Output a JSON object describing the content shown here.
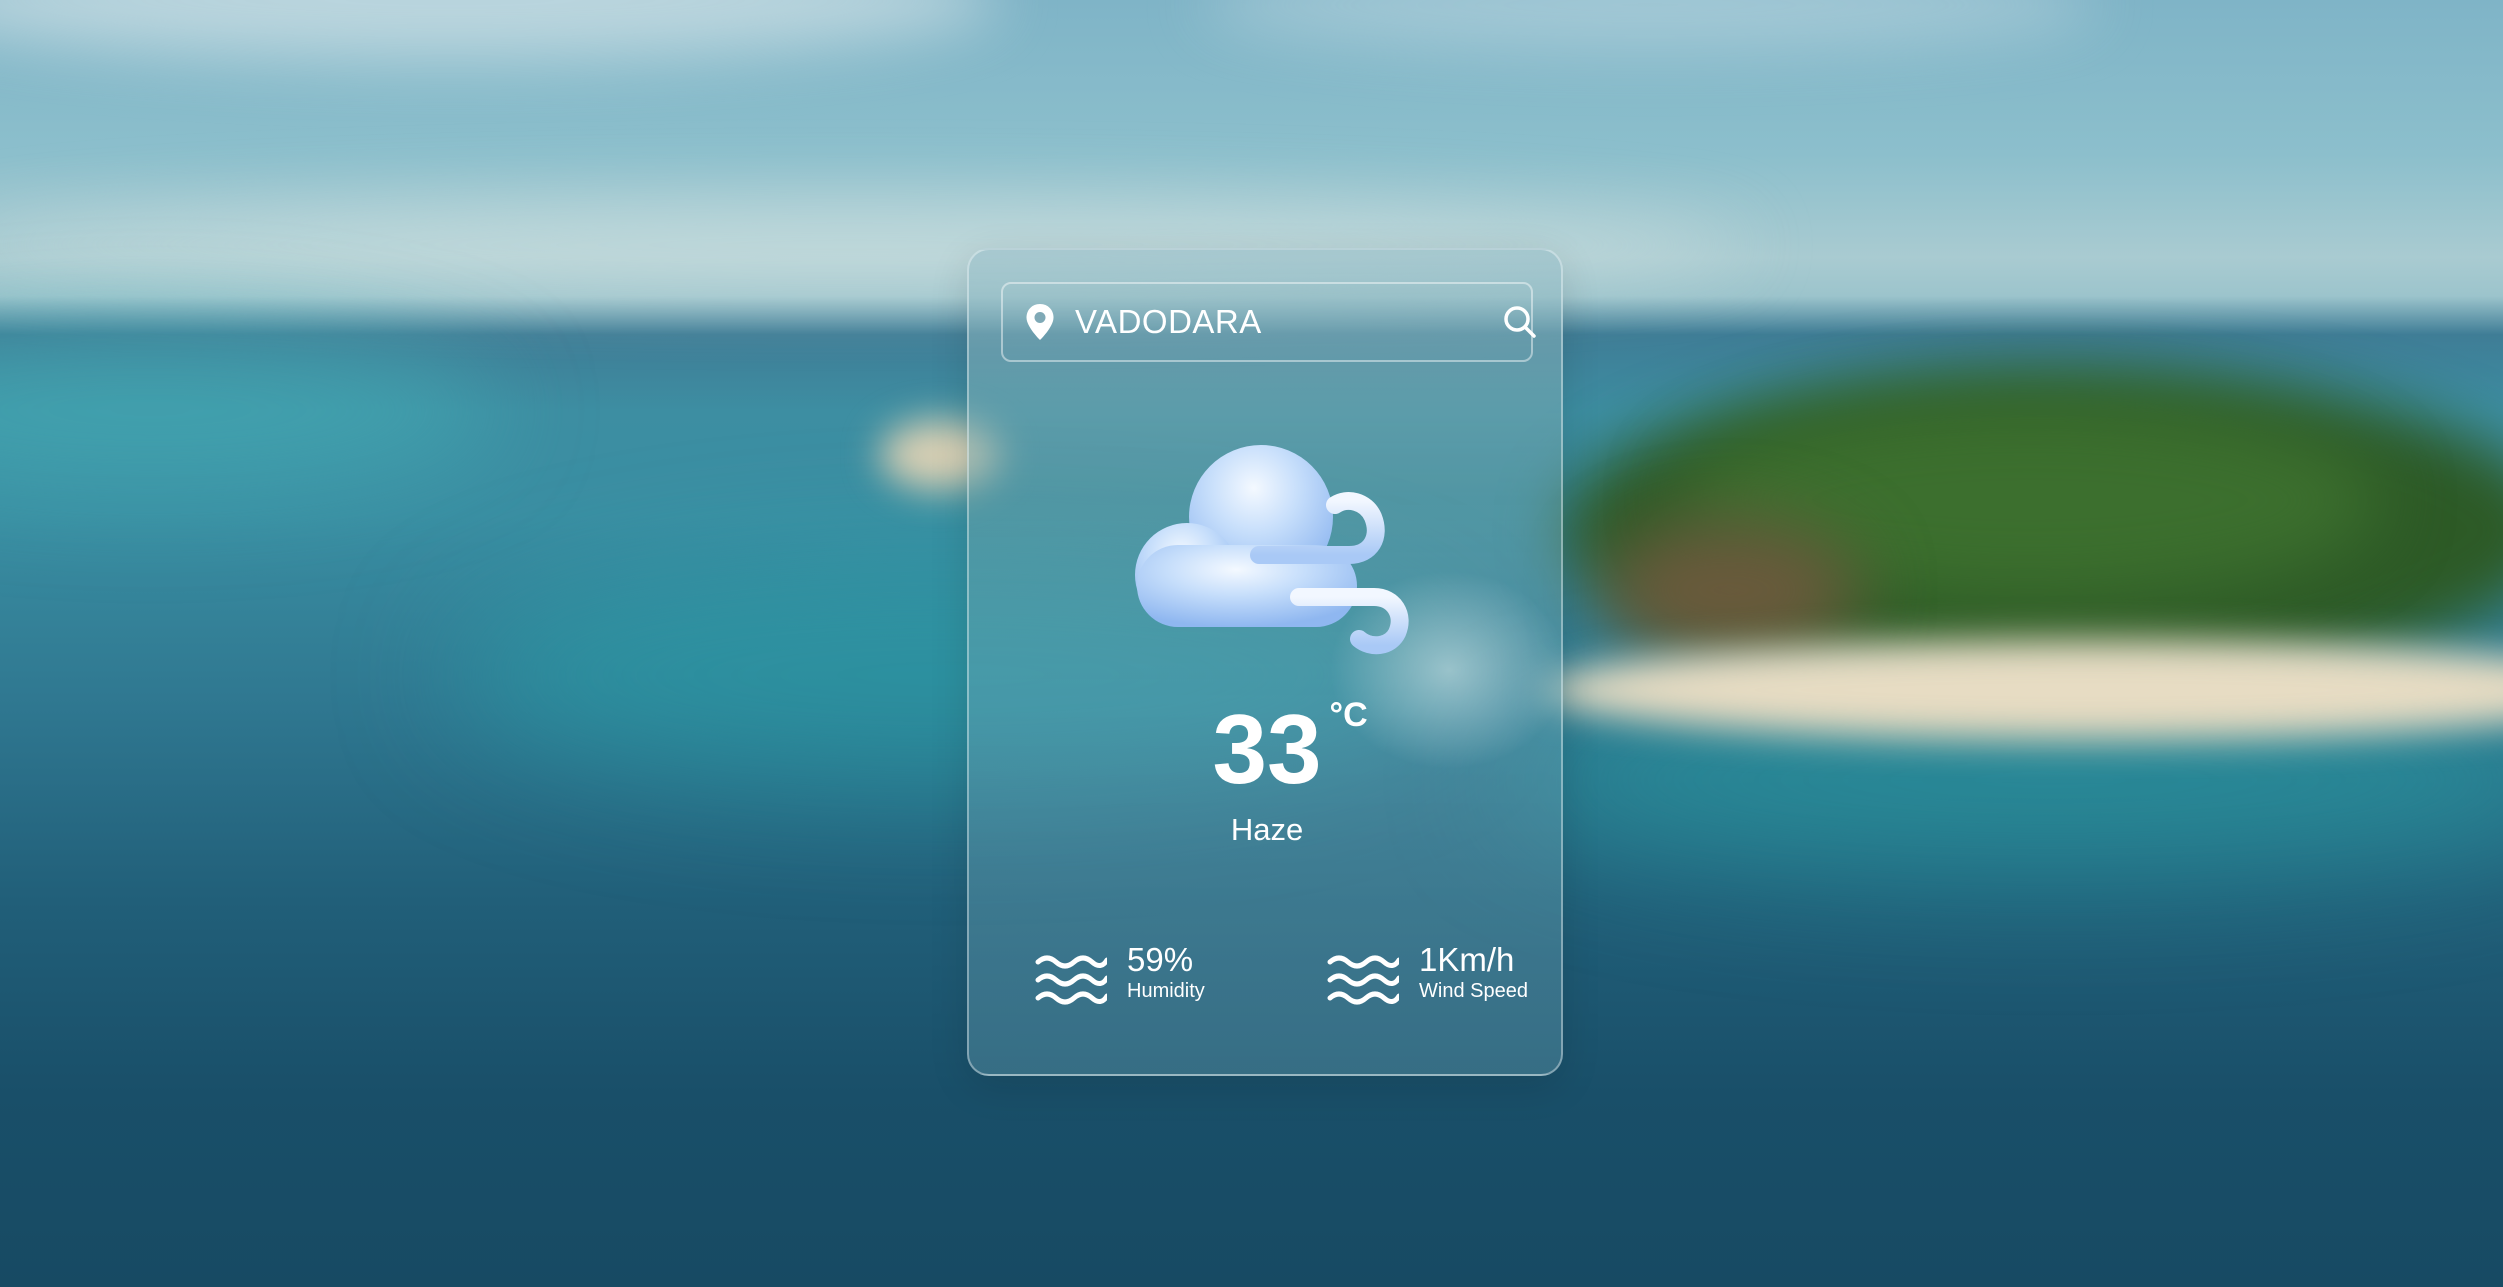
{
  "search": {
    "value": "VADODARA",
    "placeholder": "",
    "location_icon": "map-pin-icon",
    "search_icon": "search-icon"
  },
  "weather": {
    "icon": "cloud-wind-icon",
    "temperature": "33",
    "unit": "°C",
    "condition": "Haze"
  },
  "details": {
    "humidity": {
      "value": "59%",
      "label": "Humidity",
      "icon": "waves-icon"
    },
    "wind": {
      "value": "1Km/h",
      "label": "Wind Speed",
      "icon": "waves-icon"
    }
  },
  "colors": {
    "text": "#ffffff",
    "cloud": "#b9d7fb",
    "card_border": "#d8e8ec"
  }
}
